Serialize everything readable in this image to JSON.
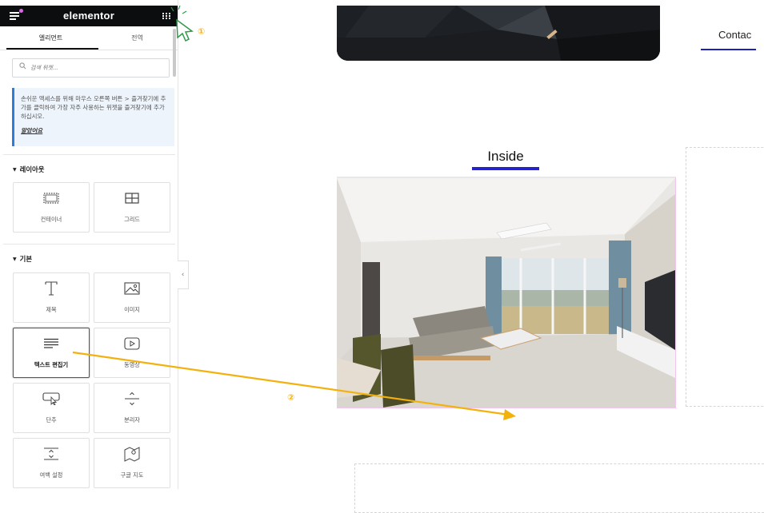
{
  "editor": {
    "brand": "elementor",
    "tabs": [
      {
        "label": "엘리먼트",
        "active": true
      },
      {
        "label": "전역",
        "active": false
      }
    ],
    "search": {
      "placeholder": "검색 위젯..."
    },
    "notice": {
      "text": "손쉬운 액세스를 위해 마우스 오른쪽 버튼 > 즐겨찾기에 추가를 클릭하여 가장 자주 사용하는 위젯을 즐겨찾기에 추가하십시오.",
      "link": "알았어요"
    },
    "sections": [
      {
        "title": "레이아웃",
        "widgets": [
          {
            "label": "컨테이너",
            "icon": "container-icon"
          },
          {
            "label": "그리드",
            "icon": "grid-layout-icon"
          }
        ]
      },
      {
        "title": "기본",
        "widgets": [
          {
            "label": "제목",
            "icon": "heading-icon"
          },
          {
            "label": "이미지",
            "icon": "image-icon"
          },
          {
            "label": "텍스트 편집기",
            "icon": "text-editor-icon",
            "selected": true
          },
          {
            "label": "동영상",
            "icon": "video-icon"
          },
          {
            "label": "단추",
            "icon": "button-icon"
          },
          {
            "label": "분리자",
            "icon": "divider-icon"
          },
          {
            "label": "여백 설정",
            "icon": "spacer-icon"
          },
          {
            "label": "구글 지도",
            "icon": "map-icon"
          }
        ]
      }
    ]
  },
  "canvas": {
    "contact_heading": "Contac",
    "inside_heading": "Inside"
  },
  "annotations": {
    "step1": "①",
    "step2": "②",
    "color": "#f3b10d"
  },
  "colors": {
    "accent_blue": "#2323c8",
    "topbar": "#0c0d0e",
    "notice_border": "#2e7cdb"
  }
}
